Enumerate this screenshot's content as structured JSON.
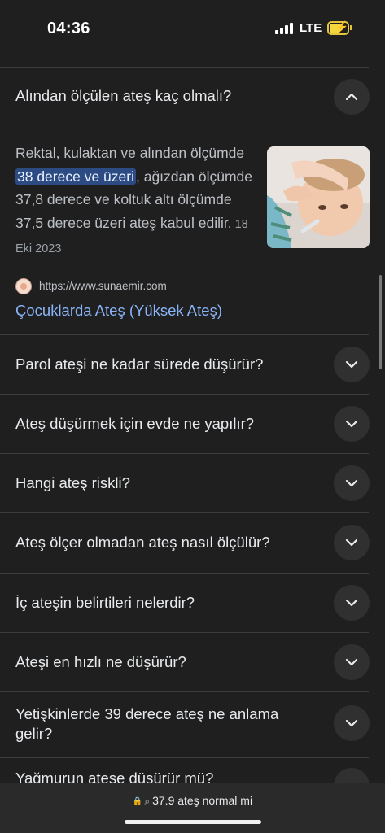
{
  "status_bar": {
    "time": "04:36",
    "network": "LTE"
  },
  "expanded_faq": {
    "question": "Alından ölçülen ateş kaç olmalı?",
    "answer_before": "Rektal, kulaktan ve alından ölçümde ",
    "answer_highlight": "38 derece ve üzeri",
    "answer_after": ", ağızdan ölçümde 37,8 derece ve koltuk altı ölçümde 37,5 derece üzeri ateş kabul edilir.",
    "date": "18 Eki 2023",
    "source_url": "https://www.sunaemir.com",
    "source_title": "Çocuklarda Ateş (Yüksek Ateş)"
  },
  "faq_items": [
    {
      "question": "Parol ateşi ne kadar sürede düşürür?"
    },
    {
      "question": "Ateş düşürmek için evde ne yapılır?"
    },
    {
      "question": "Hangi ateş riskli?"
    },
    {
      "question": "Ateş ölçer olmadan ateş nasıl ölçülür?"
    },
    {
      "question": "İç ateşin belirtileri nelerdir?"
    },
    {
      "question": "Ateşi en hızlı ne düşürür?"
    },
    {
      "question": "Yetişkinlerde 39 derece ateş ne anlama gelir?"
    }
  ],
  "partial_question": "Yağmurun ateşe düşürür mü?",
  "bottom_bar": {
    "address": "37.9 ateş normal mi"
  },
  "colors": {
    "background": "#1f1f1f",
    "link": "#8ab4f8",
    "highlight": "#2d4b83",
    "battery": "#f2d63e"
  },
  "icons": [
    "chevron-up-icon",
    "chevron-down-icon",
    "lock-icon",
    "search-icon",
    "battery-icon",
    "signal-icon",
    "site-favicon-icon"
  ]
}
